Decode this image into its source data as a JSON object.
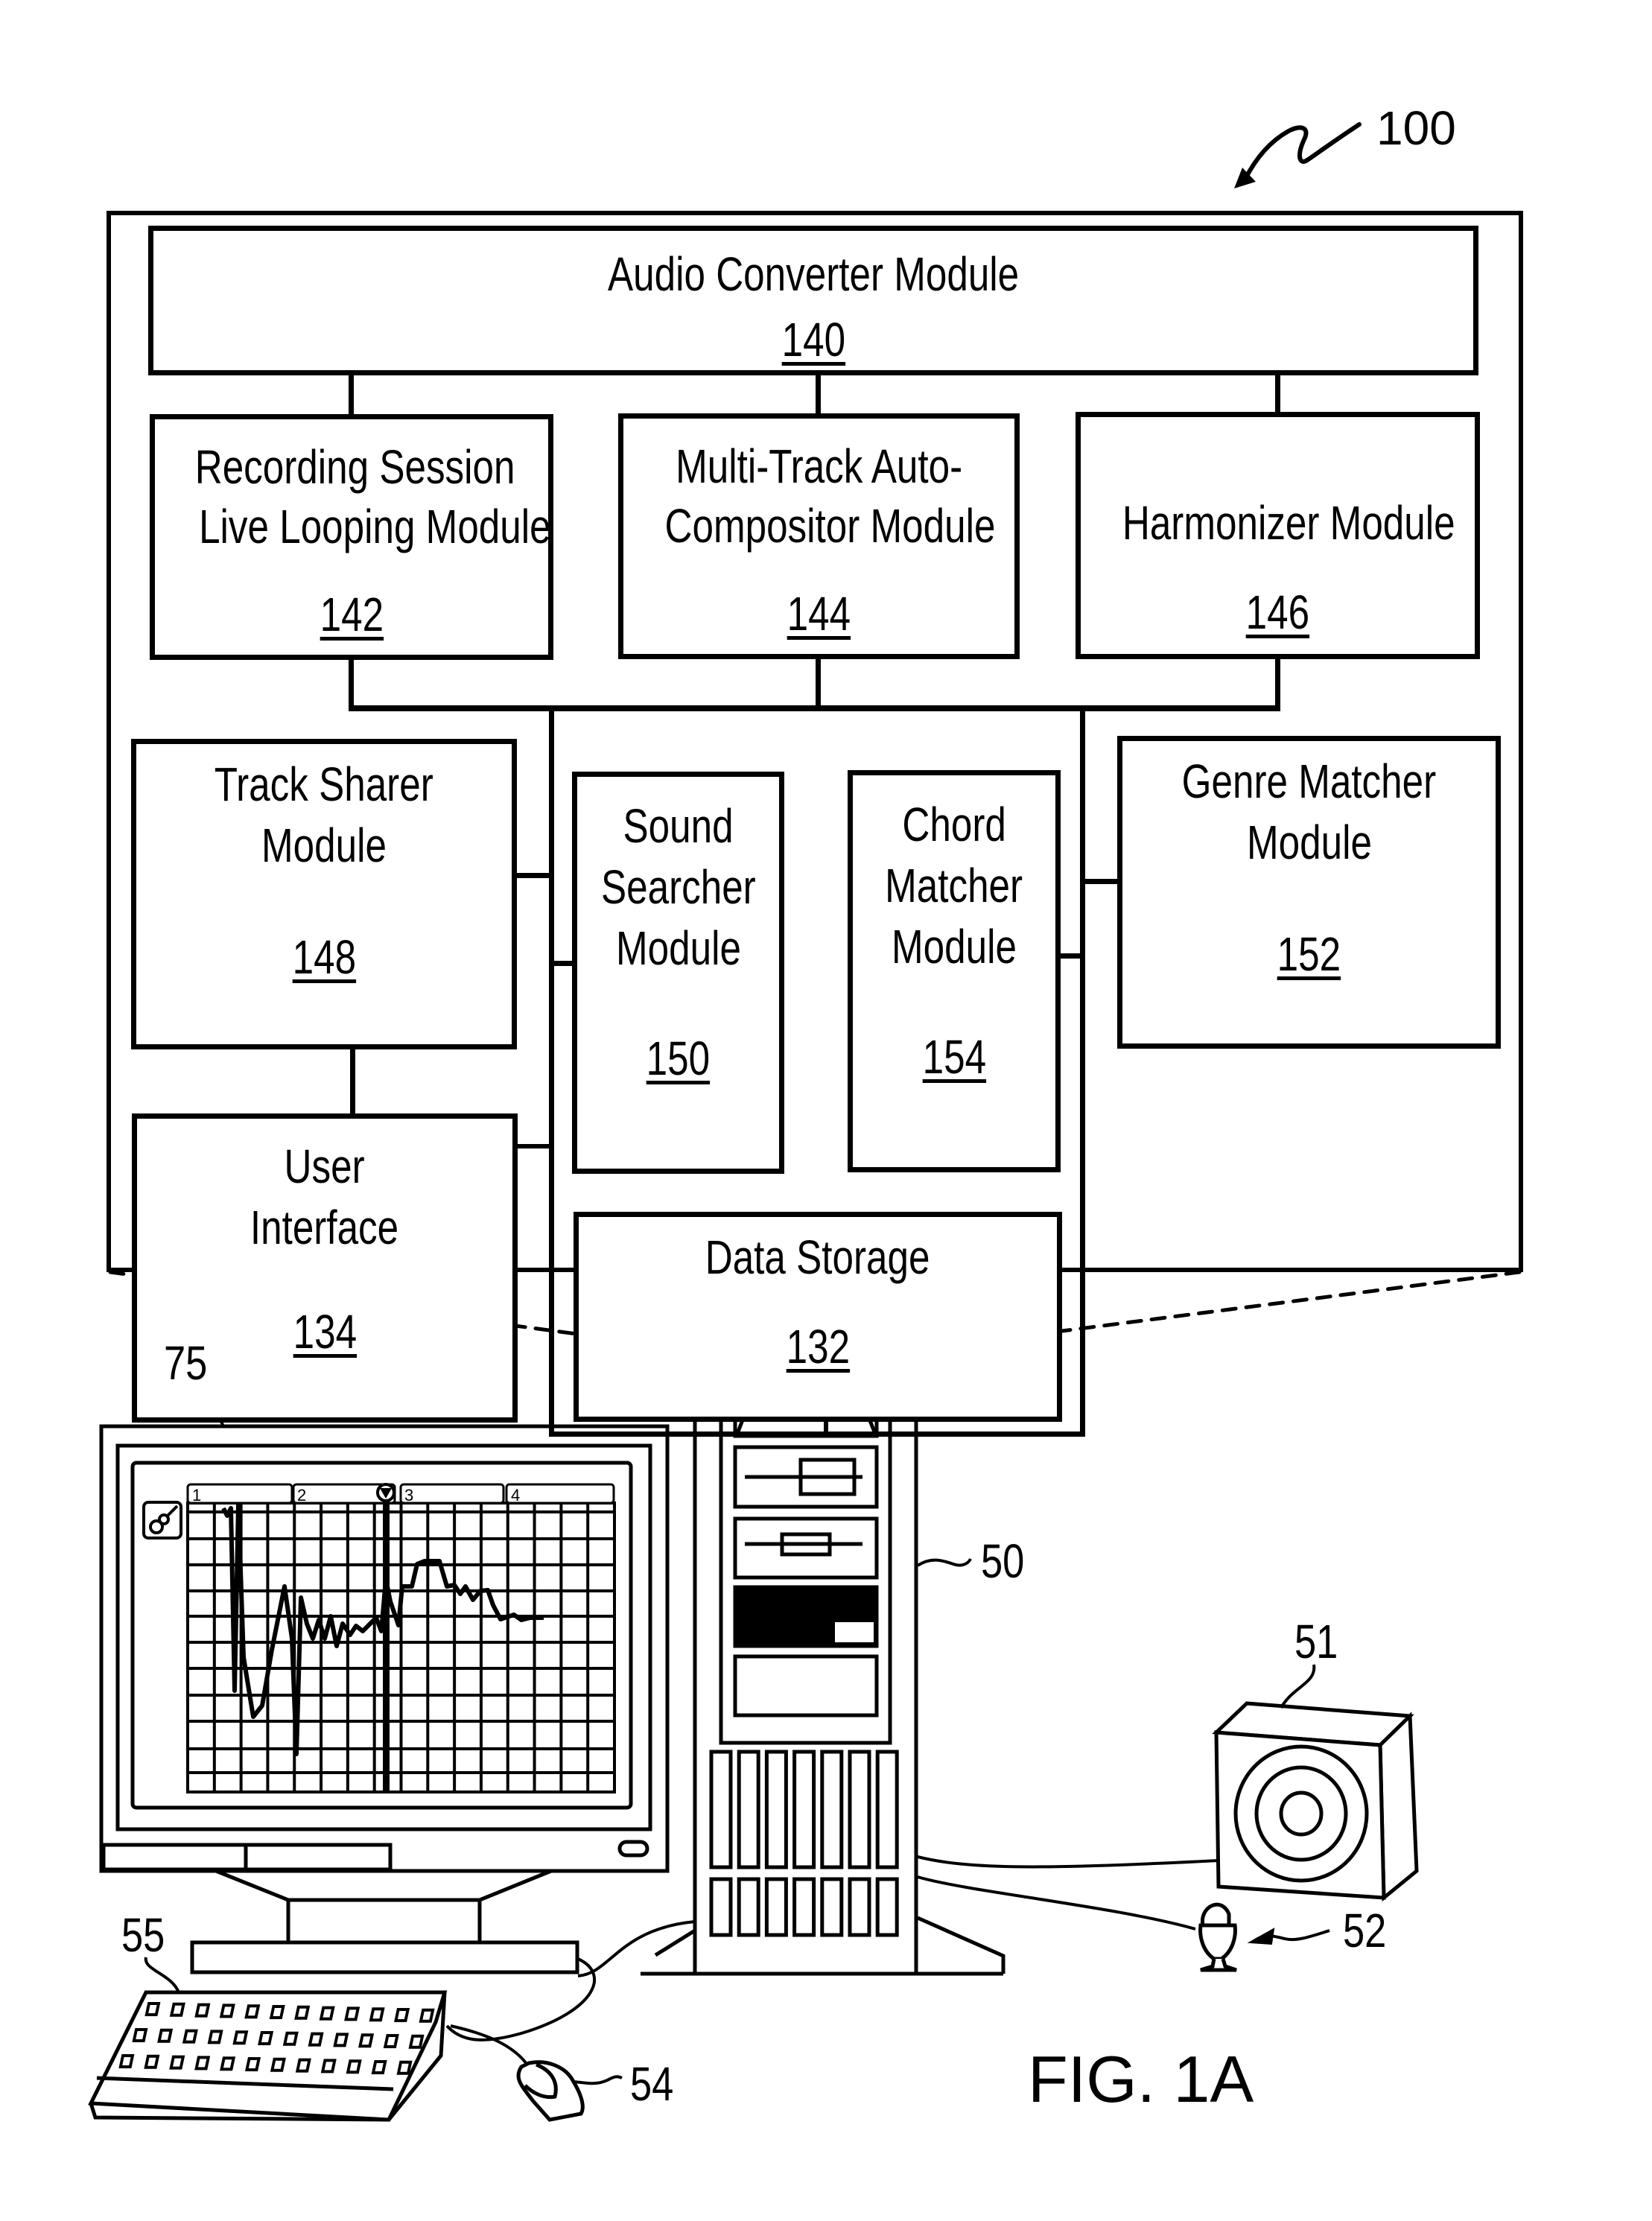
{
  "figure": {
    "reference_number": "100",
    "caption": "FIG. 1A"
  },
  "modules": {
    "audio_converter": {
      "name": "Audio Converter Module",
      "number": "140"
    },
    "recording_session": {
      "lines": [
        "Recording Session",
        "Live Looping Module"
      ],
      "number": "142"
    },
    "multi_track": {
      "lines": [
        "Multi-Track Auto-",
        "Compositor Module"
      ],
      "number": "144"
    },
    "harmonizer": {
      "lines": [
        "Harmonizer Module"
      ],
      "number": "146"
    },
    "track_sharer": {
      "lines": [
        "Track Sharer",
        "Module"
      ],
      "number": "148"
    },
    "sound_searcher": {
      "lines": [
        "Sound",
        "Searcher",
        "Module"
      ],
      "number": "150"
    },
    "chord_matcher": {
      "lines": [
        "Chord",
        "Matcher",
        "Module"
      ],
      "number": "154"
    },
    "genre_matcher": {
      "lines": [
        "Genre Matcher",
        "Module"
      ],
      "number": "152"
    },
    "user_interface": {
      "lines": [
        "User",
        "Interface"
      ],
      "number": "134"
    },
    "data_storage": {
      "name": "Data Storage",
      "number": "132"
    }
  },
  "hardware": {
    "monitor": {
      "ref": "75",
      "track_tabs": [
        "1",
        "2",
        "3",
        "4"
      ],
      "instrument_icon": "guitar-icon"
    },
    "computer_tower": {
      "ref": "50"
    },
    "speaker": {
      "ref": "51"
    },
    "microphone": {
      "ref": "52"
    },
    "mouse": {
      "ref": "54"
    },
    "keyboard": {
      "ref": "55"
    }
  }
}
